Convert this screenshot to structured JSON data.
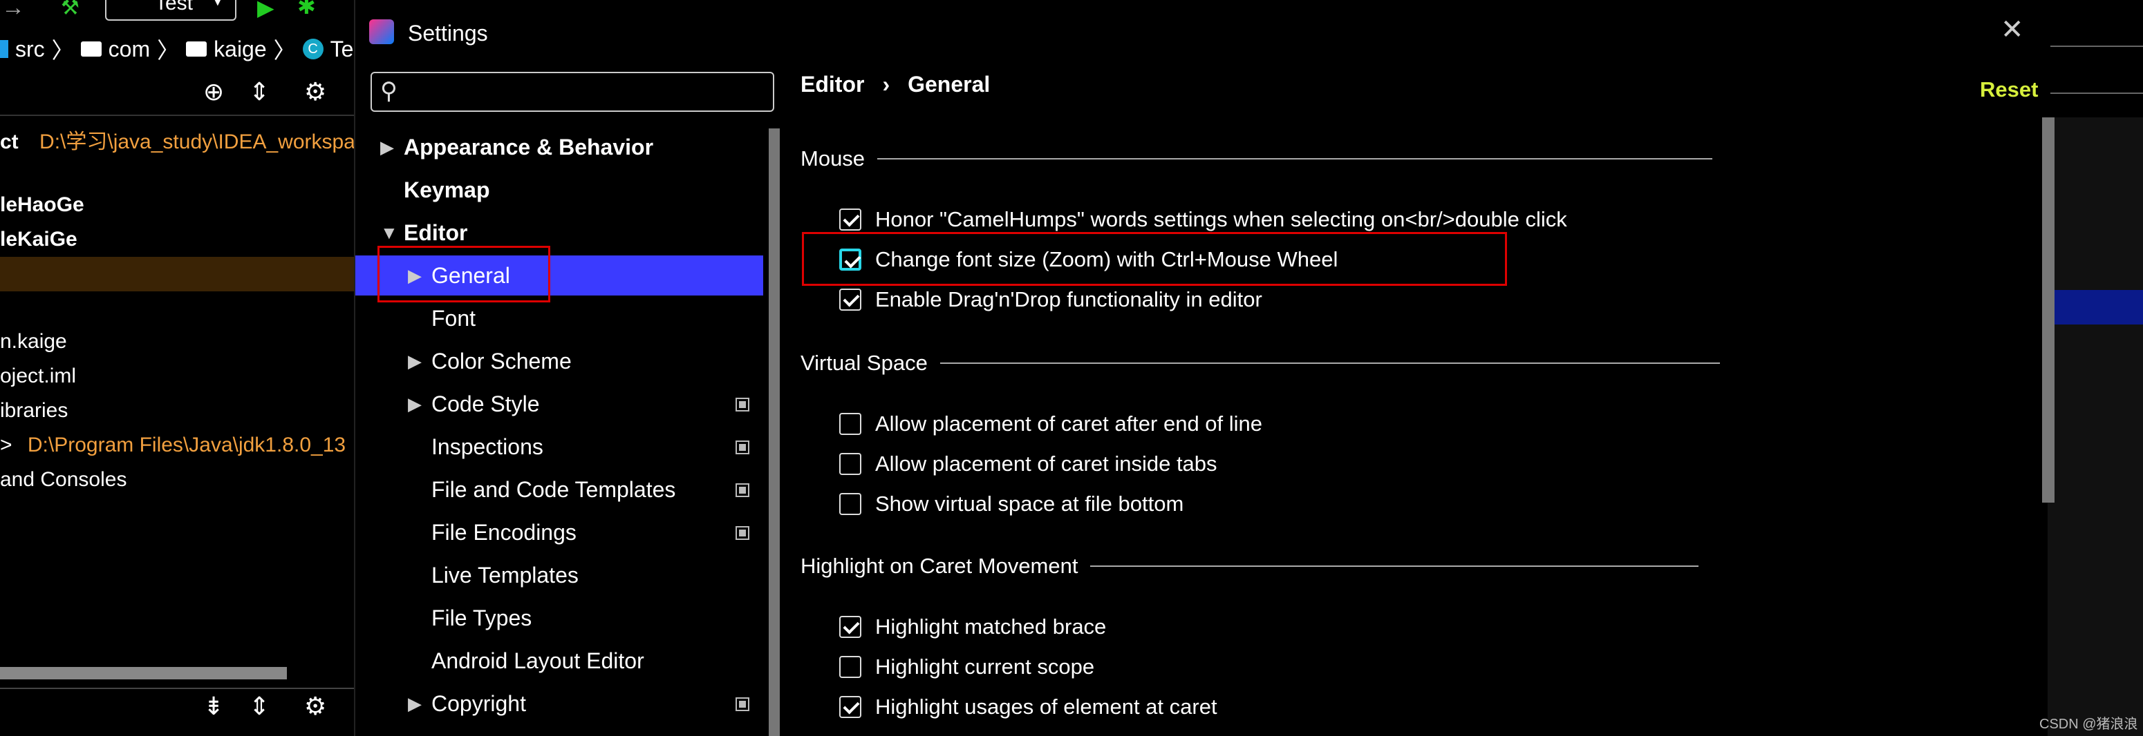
{
  "ide": {
    "run_config": "Test",
    "breadcrumb": [
      "src",
      "com",
      "kaige",
      "Test"
    ],
    "project_lines": {
      "path_prefix": "ct",
      "path_value": "D:\\学习\\java_study\\IDEA_workspa",
      "item1": "leHaoGe",
      "item2": "leKaiGe",
      "item3": "n.kaige",
      "item4": "oject.iml",
      "item5": "ibraries",
      "jdk_arrow": ">",
      "jdk_path": "D:\\Program Files\\Java\\jdk1.8.0_13",
      "item6": "and Consoles"
    }
  },
  "dialog": {
    "title": "Settings",
    "close_label": "✕",
    "search": {
      "value": "",
      "placeholder": ""
    },
    "tree": [
      {
        "label": "Appearance & Behavior",
        "arrow": "▶",
        "bold": true
      },
      {
        "label": "Keymap",
        "arrow": "",
        "bold": true
      },
      {
        "label": "Editor",
        "arrow": "▼",
        "bold": true
      },
      {
        "label": "General",
        "arrow": "▶",
        "selected": true
      },
      {
        "label": "Font",
        "arrow": ""
      },
      {
        "label": "Color Scheme",
        "arrow": "▶"
      },
      {
        "label": "Code Style",
        "arrow": "▶",
        "copy_icon": true
      },
      {
        "label": "Inspections",
        "arrow": "",
        "copy_icon": true
      },
      {
        "label": "File and Code Templates",
        "arrow": "",
        "copy_icon": true
      },
      {
        "label": "File Encodings",
        "arrow": "",
        "copy_icon": true
      },
      {
        "label": "Live Templates",
        "arrow": ""
      },
      {
        "label": "File Types",
        "arrow": ""
      },
      {
        "label": "Android Layout Editor",
        "arrow": ""
      },
      {
        "label": "Copyright",
        "arrow": "▶",
        "copy_icon": true
      }
    ],
    "content": {
      "breadcrumb_root": "Editor",
      "breadcrumb_sep": "›",
      "breadcrumb_leaf": "General",
      "reset_label": "Reset",
      "sections": {
        "mouse": "Mouse",
        "virtual_space": "Virtual Space",
        "highlight": "Highlight on Caret Movement"
      },
      "options": {
        "camel_humps": {
          "label": "Honor \"CamelHumps\" words settings when selecting on<br/>double click",
          "checked": true
        },
        "zoom": {
          "label": "Change font size (Zoom) with Ctrl+Mouse Wheel",
          "checked": true
        },
        "dnd": {
          "label": "Enable Drag'n'Drop functionality in editor",
          "checked": true
        },
        "caret_eol": {
          "label": "Allow placement of caret after end of line",
          "checked": false
        },
        "caret_tabs": {
          "label": "Allow placement of caret inside tabs",
          "checked": false
        },
        "virtual_bottom": {
          "label": "Show virtual space at file bottom",
          "checked": false
        },
        "matched_brace": {
          "label": "Highlight matched brace",
          "checked": true
        },
        "current_scope": {
          "label": "Highlight current scope",
          "checked": false
        },
        "usages": {
          "label": "Highlight usages of element at caret",
          "checked": true
        }
      }
    }
  },
  "watermark": "CSDN @猪浪浪",
  "colors": {
    "selection": "#3b3bff",
    "reset": "#d7f03c",
    "orange_path": "#f2a03f",
    "annotation_red": "#dd0000",
    "focus_cyan": "#28d7e8"
  }
}
